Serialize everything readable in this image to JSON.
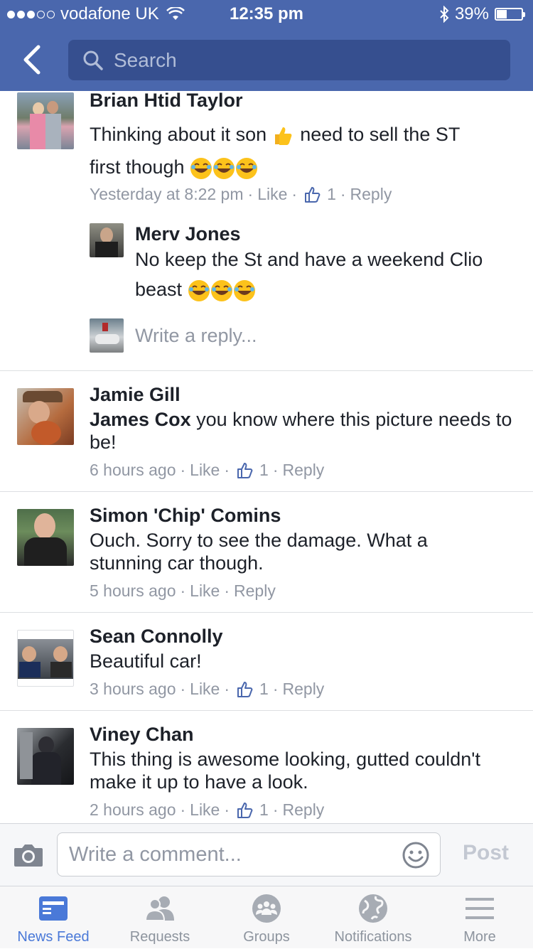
{
  "status": {
    "carrier": "vodafone UK",
    "time": "12:35 pm",
    "battery": "39%",
    "battery_level": 0.39
  },
  "search": {
    "placeholder": "Search"
  },
  "comments": [
    {
      "name": "Brian Htid Taylor",
      "text_a": "Thinking about it son",
      "text_b": "need to sell the ST",
      "text_c": "first though",
      "time": "Yesterday at 8:22 pm",
      "like": "Like",
      "count": "1",
      "reply": "Reply"
    },
    {
      "name": "Merv Jones",
      "text_a": "No keep the St and have a weekend Clio",
      "text_b": "beast"
    },
    {
      "name": "Jamie Gill",
      "mention": "James Cox",
      "text": "you know where this picture needs to be!",
      "time": "6 hours ago",
      "like": "Like",
      "count": "1",
      "reply": "Reply"
    },
    {
      "name": "Simon 'Chip' Comins",
      "text": "Ouch. Sorry to see the damage. What a stunning car though.",
      "time": "5 hours ago",
      "like": "Like",
      "reply": "Reply"
    },
    {
      "name": "Sean Connolly",
      "text": "Beautiful car!",
      "time": "3 hours ago",
      "like": "Like",
      "count": "1",
      "reply": "Reply"
    },
    {
      "name": "Viney Chan",
      "text": "This thing is awesome looking, gutted couldn't make it up to have a look.",
      "time": "2 hours ago",
      "like": "Like",
      "count": "1",
      "reply": "Reply"
    }
  ],
  "reply_box": {
    "placeholder": "Write a reply..."
  },
  "composer": {
    "placeholder": "Write a comment...",
    "post": "Post"
  },
  "tabs": [
    {
      "label": "News Feed",
      "icon": "news-feed-icon",
      "active": true
    },
    {
      "label": "Requests",
      "icon": "requests-icon"
    },
    {
      "label": "Groups",
      "icon": "groups-icon"
    },
    {
      "label": "Notifications",
      "icon": "globe-icon"
    },
    {
      "label": "More",
      "icon": "menu-icon"
    }
  ],
  "colors": {
    "brand": "#4a67ad",
    "search_bg": "#364f8f",
    "active_tab": "#4a79d8",
    "meta": "#9197a3"
  }
}
